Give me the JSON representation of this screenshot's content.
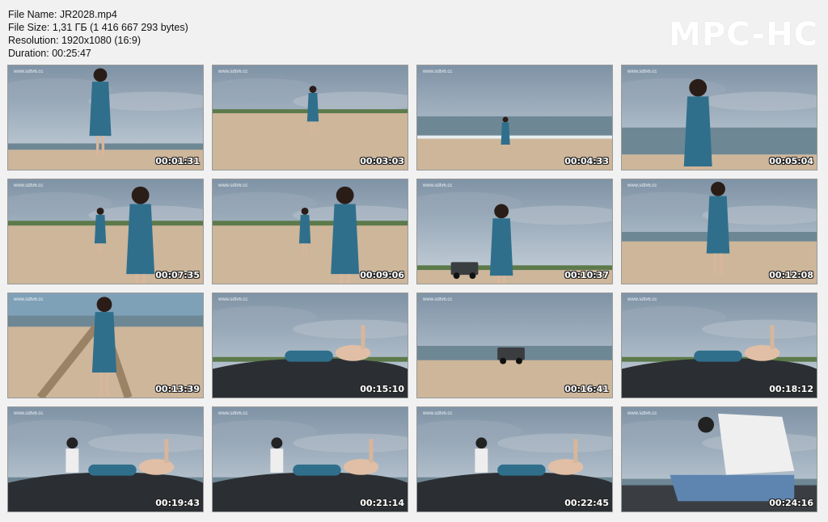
{
  "file_info": {
    "name": "File Name: JR2028.mp4",
    "size": "File Size: 1,31 ГБ (1 416 667 293 bytes)",
    "resolution": "Resolution: 1920x1080 (16:9)",
    "duration": "Duration: 00:25:47"
  },
  "logo": "MPC-HC",
  "watermark": "www.sdtv6.cc",
  "thumbnails": [
    {
      "time": "00:01:31",
      "scene": "beach-standing"
    },
    {
      "time": "00:03:03",
      "scene": "beach-walking"
    },
    {
      "time": "00:04:33",
      "scene": "shoreline"
    },
    {
      "time": "00:05:04",
      "scene": "closeup-sea"
    },
    {
      "time": "00:07:35",
      "scene": "two-women"
    },
    {
      "time": "00:09:06",
      "scene": "two-women"
    },
    {
      "time": "00:10:37",
      "scene": "jeep-beach"
    },
    {
      "time": "00:12:08",
      "scene": "beach-standing-back"
    },
    {
      "time": "00:13:39",
      "scene": "tracks"
    },
    {
      "time": "00:15:10",
      "scene": "car-hood"
    },
    {
      "time": "00:16:41",
      "scene": "jeep-far"
    },
    {
      "time": "00:18:12",
      "scene": "car-hood"
    },
    {
      "time": "00:19:43",
      "scene": "car-hood-man"
    },
    {
      "time": "00:21:14",
      "scene": "car-hood-man"
    },
    {
      "time": "00:22:45",
      "scene": "car-hood-man"
    },
    {
      "time": "00:24:16",
      "scene": "sitting-man"
    }
  ]
}
